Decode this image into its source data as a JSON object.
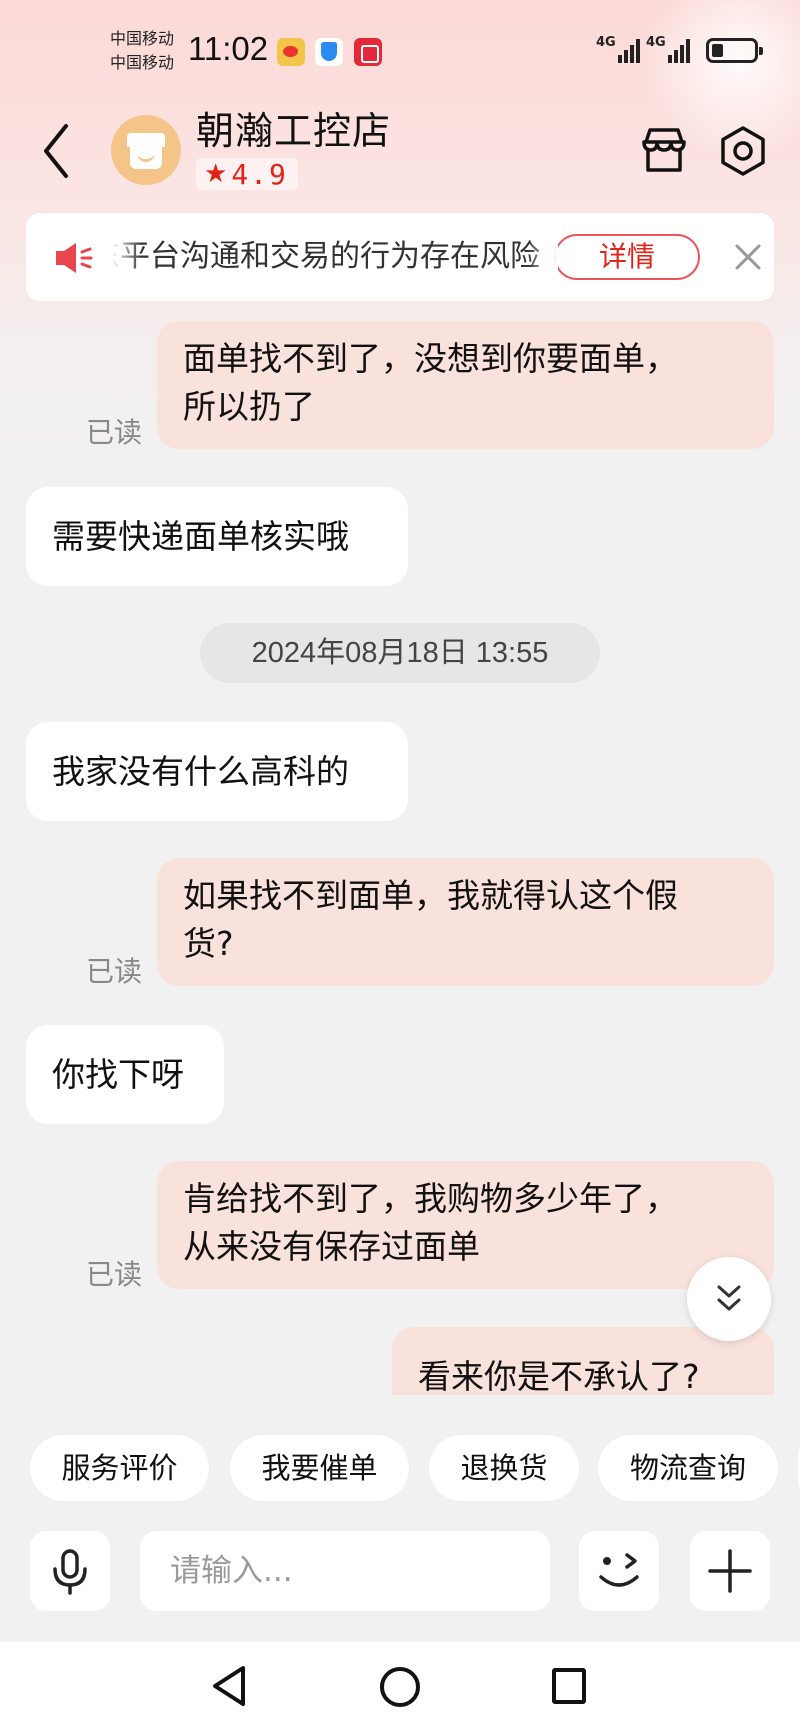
{
  "status_bar": {
    "carrier_1": "中国移动",
    "carrier_2": "中国移动",
    "time": "11:02",
    "network_1": "4G",
    "network_2": "4G",
    "app_icons": [
      "weibo-icon",
      "shield-icon",
      "gift-icon"
    ]
  },
  "header": {
    "shop_name": "朝瀚工控店",
    "rating": "4.9",
    "icons": [
      "back-arrow-icon",
      "store-icon",
      "settings-icon"
    ]
  },
  "notice": {
    "text": "东平台沟通和交易的行为存在风险",
    "detail_label": "详情"
  },
  "chat": {
    "messages": [
      {
        "side": "out",
        "text": "面单找不到了，没想到你要面单，\n所以扔了",
        "read": "已读"
      },
      {
        "side": "in",
        "text": "需要快递面单核实哦"
      },
      {
        "side": "in",
        "text": "我家没有什么高科的"
      },
      {
        "side": "out",
        "text": "如果找不到面单，我就得认这个假\n货?",
        "read": "已读"
      },
      {
        "side": "in",
        "text": "你找下呀"
      },
      {
        "side": "out",
        "text": "肯给找不到了，我购物多少年了，\n从来没有保存过面单",
        "read": "已读"
      },
      {
        "side": "out",
        "text": "看来你是不承认了?"
      }
    ],
    "timestamp": "2024年08月18日  13:55"
  },
  "quick_replies": [
    "服务评价",
    "我要催单",
    "退换货",
    "物流查询"
  ],
  "input": {
    "placeholder": "请输入..."
  },
  "colors": {
    "accent": "#e2231a",
    "outgoing_bubble": "#f9e1dc",
    "incoming_bubble": "#ffffff",
    "background": "#f1f1f1"
  }
}
